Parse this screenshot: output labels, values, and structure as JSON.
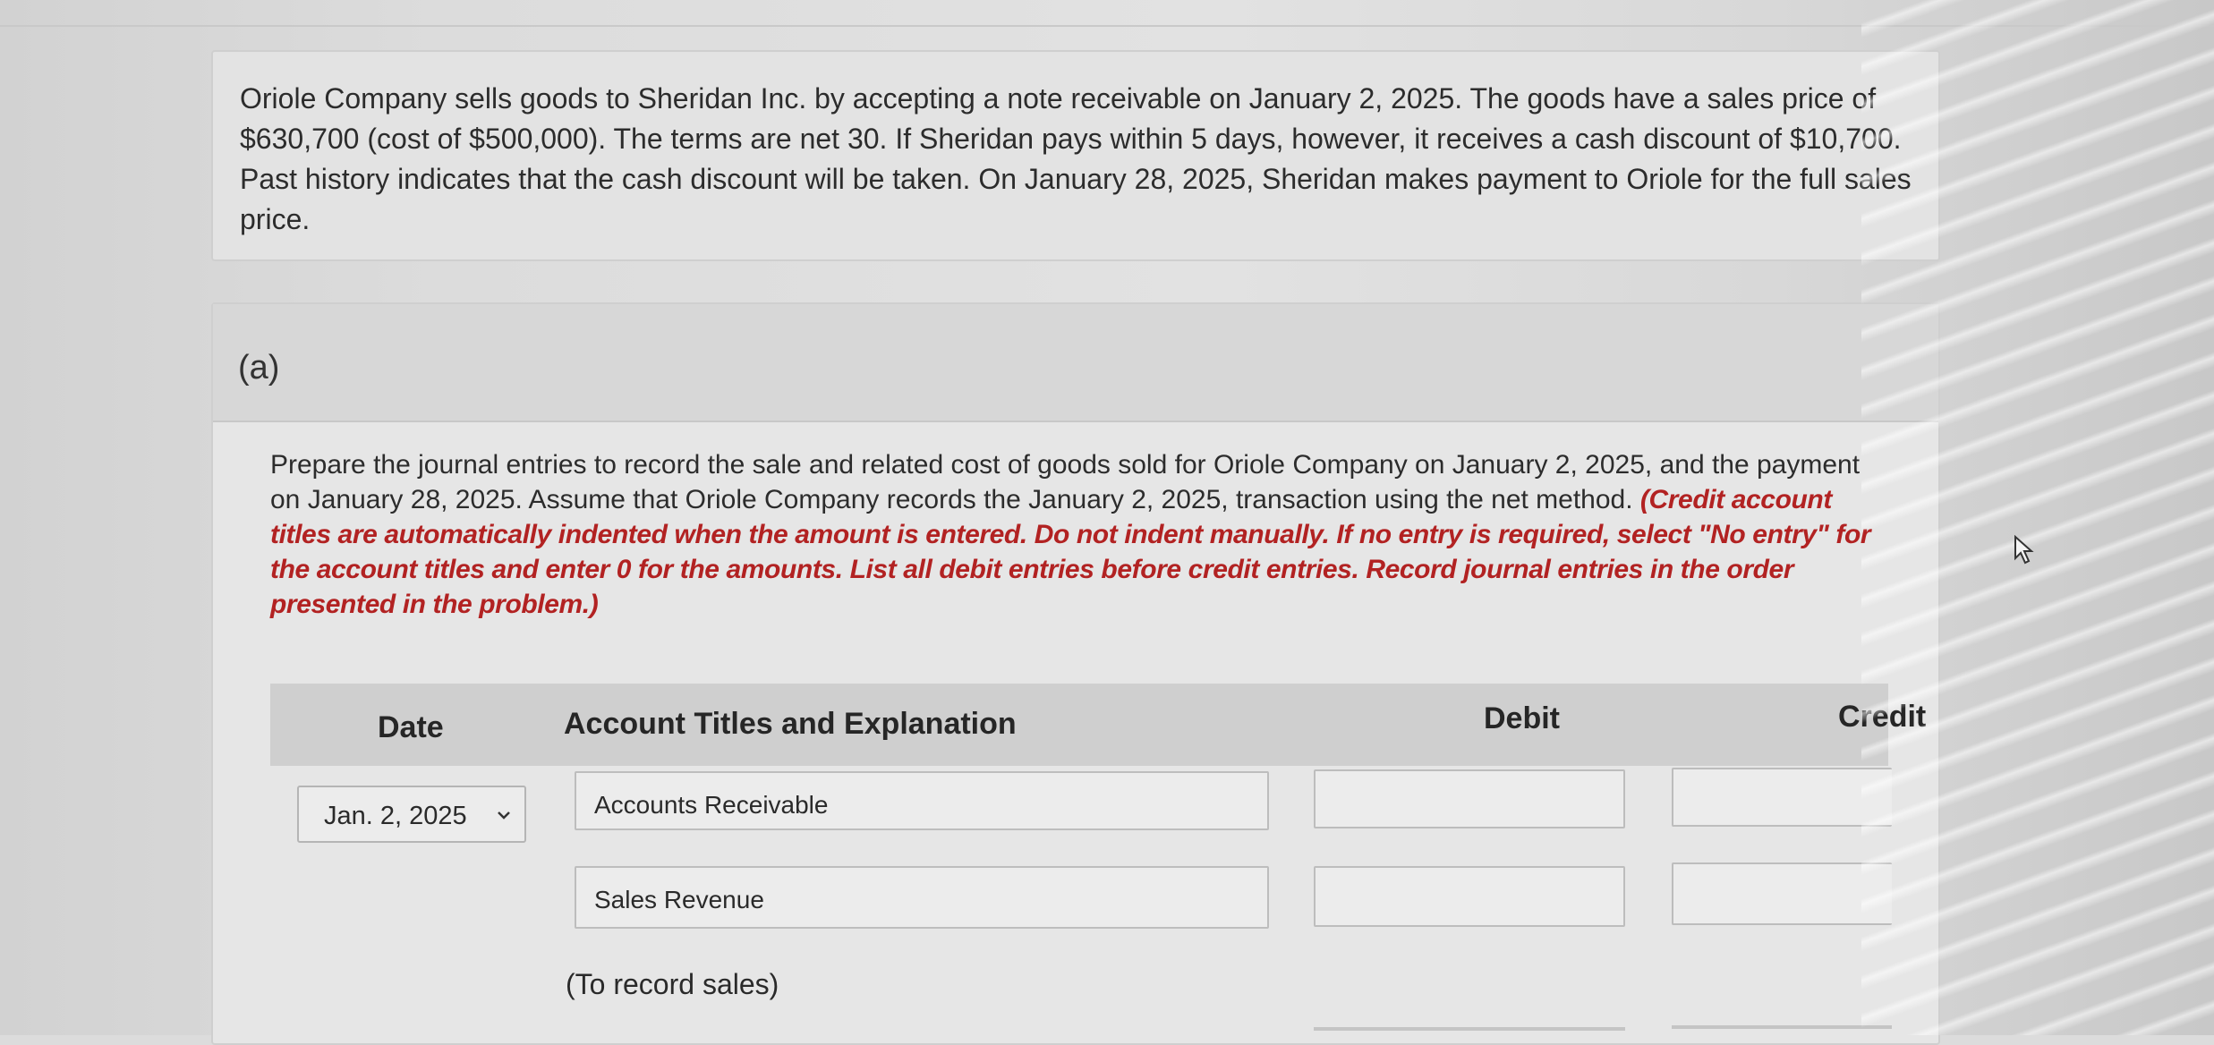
{
  "problem": {
    "text": "Oriole Company sells goods to Sheridan Inc. by accepting a note receivable on January 2, 2025. The goods have a sales price of $630,700 (cost of $500,000). The terms are net 30. If Sheridan pays within 5 days, however, it receives a cash discount of $10,700. Past history indicates that the cash discount will be taken. On January 28, 2025, Sheridan makes payment to Oriole for the full sales price."
  },
  "part": {
    "label": "(a)",
    "instruction": "Prepare the journal entries to record the sale and related cost of goods sold for Oriole Company on January 2, 2025, and the payment on January 28, 2025. Assume that Oriole Company records the January 2, 2025, transaction using the net method.",
    "note": "(Credit account titles are automatically indented when the amount is entered. Do not indent manually. If no entry is required, select \"No entry\" for the account titles and enter 0 for the amounts. List all debit entries before credit entries. Record journal entries in the order presented in the problem.)"
  },
  "table": {
    "headers": {
      "date": "Date",
      "account": "Account Titles and Explanation",
      "debit": "Debit",
      "credit": "Credit"
    },
    "entry": {
      "date": "Jan. 2, 2025",
      "rows": [
        {
          "account": "Accounts Receivable",
          "debit": "",
          "credit": ""
        },
        {
          "account": "Sales Revenue",
          "debit": "",
          "credit": ""
        }
      ],
      "explanation": "(To record sales)"
    }
  }
}
